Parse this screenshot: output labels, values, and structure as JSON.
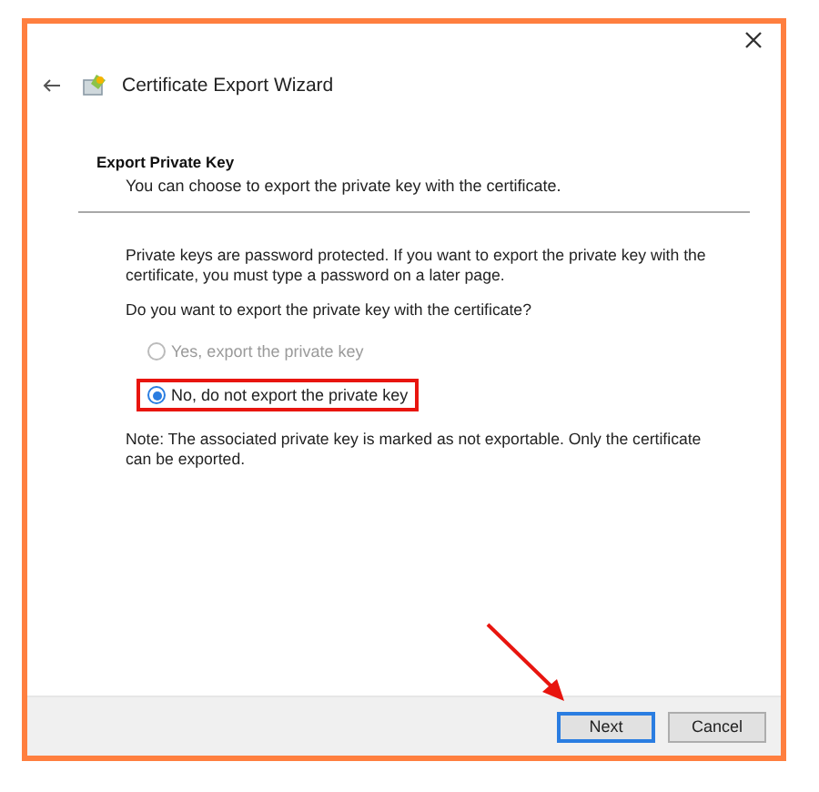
{
  "window": {
    "title": "Certificate Export Wizard"
  },
  "page": {
    "heading": "Export Private Key",
    "subheading": "You can choose to export the private key with the certificate."
  },
  "paragraphs": [
    "Private keys are password protected. If you want to export the private key with the certificate, you must type a password on a later page.",
    "Do you want to export the private key with the certificate?"
  ],
  "options": [
    {
      "label": "Yes, export the private key",
      "selected": false,
      "disabled": true,
      "highlighted": false
    },
    {
      "label": "No, do not export the private key",
      "selected": true,
      "disabled": false,
      "highlighted": true
    }
  ],
  "note": "Note: The associated private key is marked as not exportable. Only the certificate can be exported.",
  "buttons": [
    {
      "label": "Next",
      "default": true
    },
    {
      "label": "Cancel",
      "default": false
    }
  ],
  "annotation": {
    "kind": "arrow"
  }
}
